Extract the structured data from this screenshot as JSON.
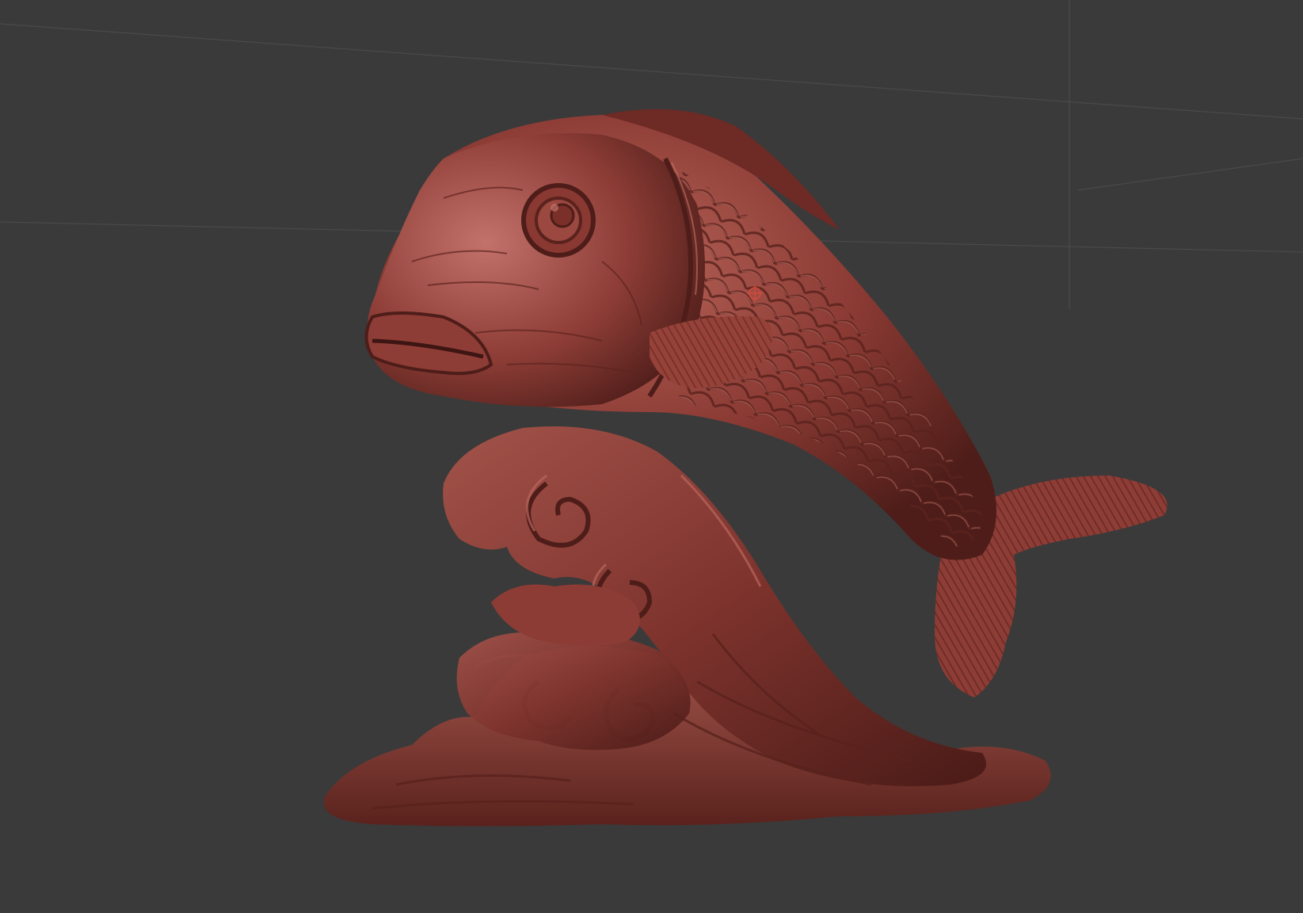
{
  "viewport": {
    "background": "#3a3a3a",
    "grid_color": "#4a4a4a",
    "material_color": "#8a3a33",
    "material_highlight": "#b8655a",
    "material_shadow": "#4e1d19"
  },
  "model": {
    "subject": "koi-fish-on-wave-sculpt"
  },
  "cursor": {
    "icon": "crosshair-icon",
    "color": "#d34a3a"
  }
}
